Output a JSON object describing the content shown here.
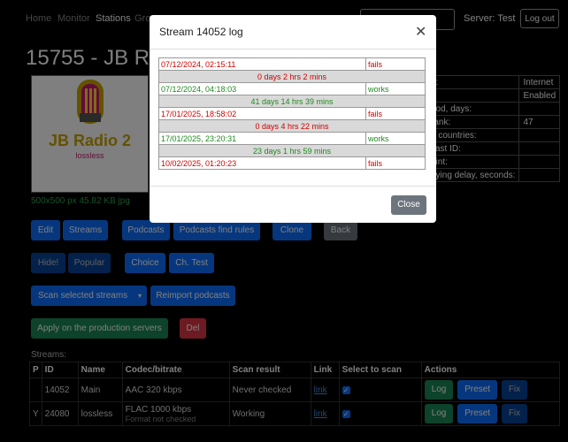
{
  "nav": {
    "items": [
      "Home",
      "Monitor",
      "Stations",
      "Gro"
    ],
    "server_label": "Server: Test",
    "logout_label": "Log out"
  },
  "page": {
    "title": "15755 - JB Ra",
    "logo_name": "JB Radio 2",
    "logo_sub": "lossless",
    "image_info": "500x500 px 45.82 KB jpg"
  },
  "info_rows": [
    [
      "n:",
      "Internet"
    ],
    [
      "",
      "Enabled"
    ],
    [
      "riod, days:",
      ""
    ],
    [
      "rank:",
      "47"
    ],
    [
      "d countries:",
      ""
    ],
    [
      "cast ID:",
      ""
    ],
    [
      "oint:",
      ""
    ],
    [
      "aying delay, seconds:",
      ""
    ]
  ],
  "buttons": {
    "edit": "Edit",
    "streams": "Streams",
    "podcasts": "Podcasts",
    "podcasts_find_rules": "Podcasts find rules",
    "clone": "Clone",
    "back": "Back",
    "hide": "Hide!",
    "popular": "Popular",
    "choice": "Choice",
    "ch_test": "Ch. Test",
    "scan_selected": "Scan selected streams",
    "reimport": "Reimport podcasts",
    "apply_prod": "Apply on the production servers",
    "del": "Del"
  },
  "streams": {
    "title": "Streams:",
    "headers": [
      "P",
      "ID",
      "Name",
      "Codec/bitrate",
      "Scan result",
      "Link",
      "Select to scan",
      "Actions"
    ],
    "rows": [
      {
        "p": "",
        "id": "14052",
        "name": "Main",
        "codec": "AAC 320 kbps",
        "codec_note": "",
        "scan": "Never checked",
        "link": "link"
      },
      {
        "p": "Y",
        "id": "24080",
        "name": "lossless",
        "codec": "FLAC 1000 kbps",
        "codec_note": "Format not checked",
        "scan": "Working",
        "link": "link"
      }
    ],
    "action_labels": [
      "Log",
      "Preset",
      "Fix"
    ]
  },
  "modal": {
    "title": "Stream 14052 log",
    "close_label": "Close",
    "log": [
      {
        "time": "07/12/2024, 02:15:11",
        "status": "fails"
      },
      {
        "gap": "0 days 2 hrs 2 mins"
      },
      {
        "time": "07/12/2024, 04:18:03",
        "status": "works"
      },
      {
        "gap": "41 days 14 hrs 39 mins"
      },
      {
        "time": "17/01/2025, 18:58:02",
        "status": "fails"
      },
      {
        "gap": "0 days 4 hrs 22 mins"
      },
      {
        "time": "17/01/2025, 23:20:31",
        "status": "works"
      },
      {
        "gap": "23 days 1 hrs 59 mins"
      },
      {
        "time": "10/02/2025, 01:20:23",
        "status": "fails"
      }
    ]
  },
  "colors": {
    "primary": "#0d6efd",
    "success": "#198754",
    "danger": "#dc3545",
    "secondary": "#6c757d",
    "fail_text": "#d10000",
    "work_text": "#1e8a1e"
  }
}
